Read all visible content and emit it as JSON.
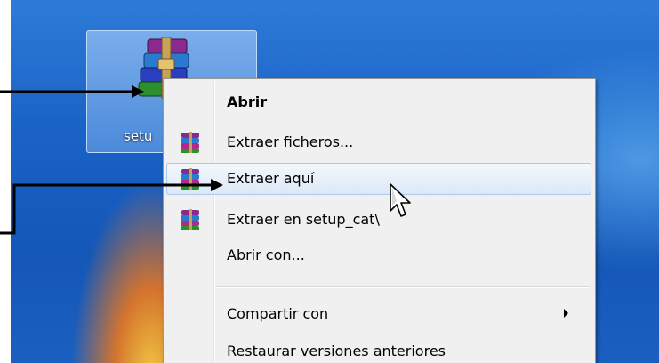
{
  "desktop": {
    "icon_label": "setu"
  },
  "context_menu": {
    "items": [
      {
        "label": "Abrir",
        "bold": true,
        "icon": ""
      },
      {
        "label": "Extraer ficheros...",
        "icon": "winrar-icon"
      },
      {
        "label": "Extraer aquí",
        "icon": "winrar-icon",
        "highlighted": true
      },
      {
        "label": "Extraer en setup_cat\\",
        "icon": "winrar-icon"
      },
      {
        "label": "Abrir con...",
        "icon": ""
      },
      {
        "label": "Compartir con",
        "icon": "",
        "submenu": true
      },
      {
        "label": "Restaurar versiones anteriores",
        "icon": ""
      }
    ]
  },
  "colors": {
    "desktop_blue": "#1a63c6",
    "menu_bg": "#f0f0f0",
    "highlight": "#dce8f7",
    "annotation_arrow": "#000000"
  }
}
